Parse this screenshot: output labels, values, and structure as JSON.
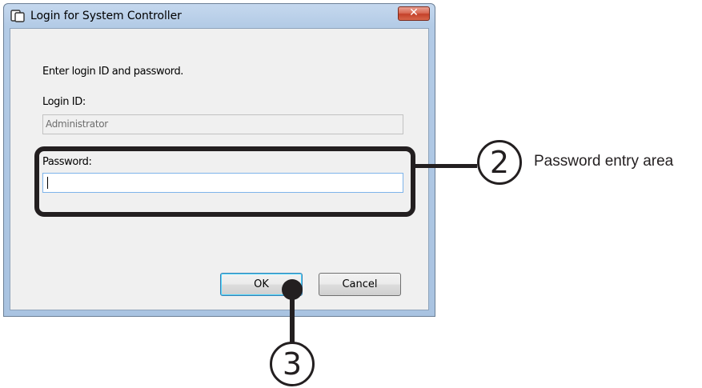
{
  "window": {
    "title": "Login for System Controller",
    "close_label": "✕"
  },
  "form": {
    "prompt": "Enter login ID and password.",
    "login_id_label": "Login ID:",
    "login_id_value": "Administrator",
    "password_label": "Password:",
    "password_value": ""
  },
  "buttons": {
    "ok_label": "OK",
    "cancel_label": "Cancel"
  },
  "callouts": {
    "two": "2",
    "three": "3",
    "password_area_text": "Password entry area"
  },
  "colors": {
    "frame": "#b3cbe6",
    "client": "#f0f0f0",
    "close_button": "#c4412a",
    "callout": "#231f20",
    "focus_border": "#7eb4ea"
  }
}
